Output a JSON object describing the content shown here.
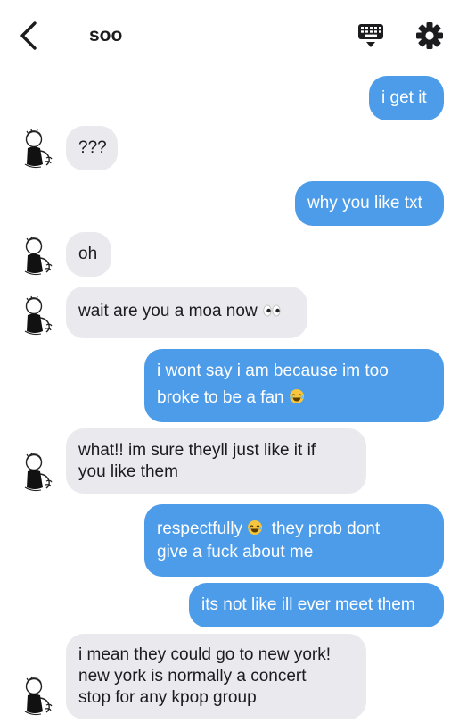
{
  "header": {
    "back_icon": "chevron-left-icon",
    "title": "soo",
    "keyboard_icon": "keyboard-icon",
    "settings_icon": "gear-icon"
  },
  "colors": {
    "outgoing_bubble": "#4c9ce9",
    "incoming_bubble": "#e9e9ee",
    "text": "#1c1c1e"
  },
  "messages": [
    {
      "side": "out",
      "lines": [
        "i get it"
      ]
    },
    {
      "side": "in",
      "lines": [
        "???"
      ]
    },
    {
      "side": "out",
      "lines": [
        "why you like txt"
      ]
    },
    {
      "side": "in",
      "lines": [
        "oh"
      ]
    },
    {
      "side": "in",
      "lines": [
        "wait are you a moa now"
      ],
      "emoji": "eyes-emoji"
    },
    {
      "side": "out",
      "lines": [
        "i wont say i am because im too",
        "broke to be a fan"
      ],
      "emoji": "laughing-emoji"
    },
    {
      "side": "in",
      "lines": [
        "what!! im sure theyll just like it if",
        "you like them"
      ]
    },
    {
      "side": "out",
      "lines": [
        "respectfully",
        "they prob dont",
        "give a fuck about me"
      ],
      "emoji": "laughing-emoji"
    },
    {
      "side": "out",
      "lines": [
        "its not like ill ever meet them"
      ]
    },
    {
      "side": "in",
      "lines": [
        "i mean they could go to new york!",
        "new york is normally a concert",
        "stop for any kpop group"
      ]
    }
  ]
}
